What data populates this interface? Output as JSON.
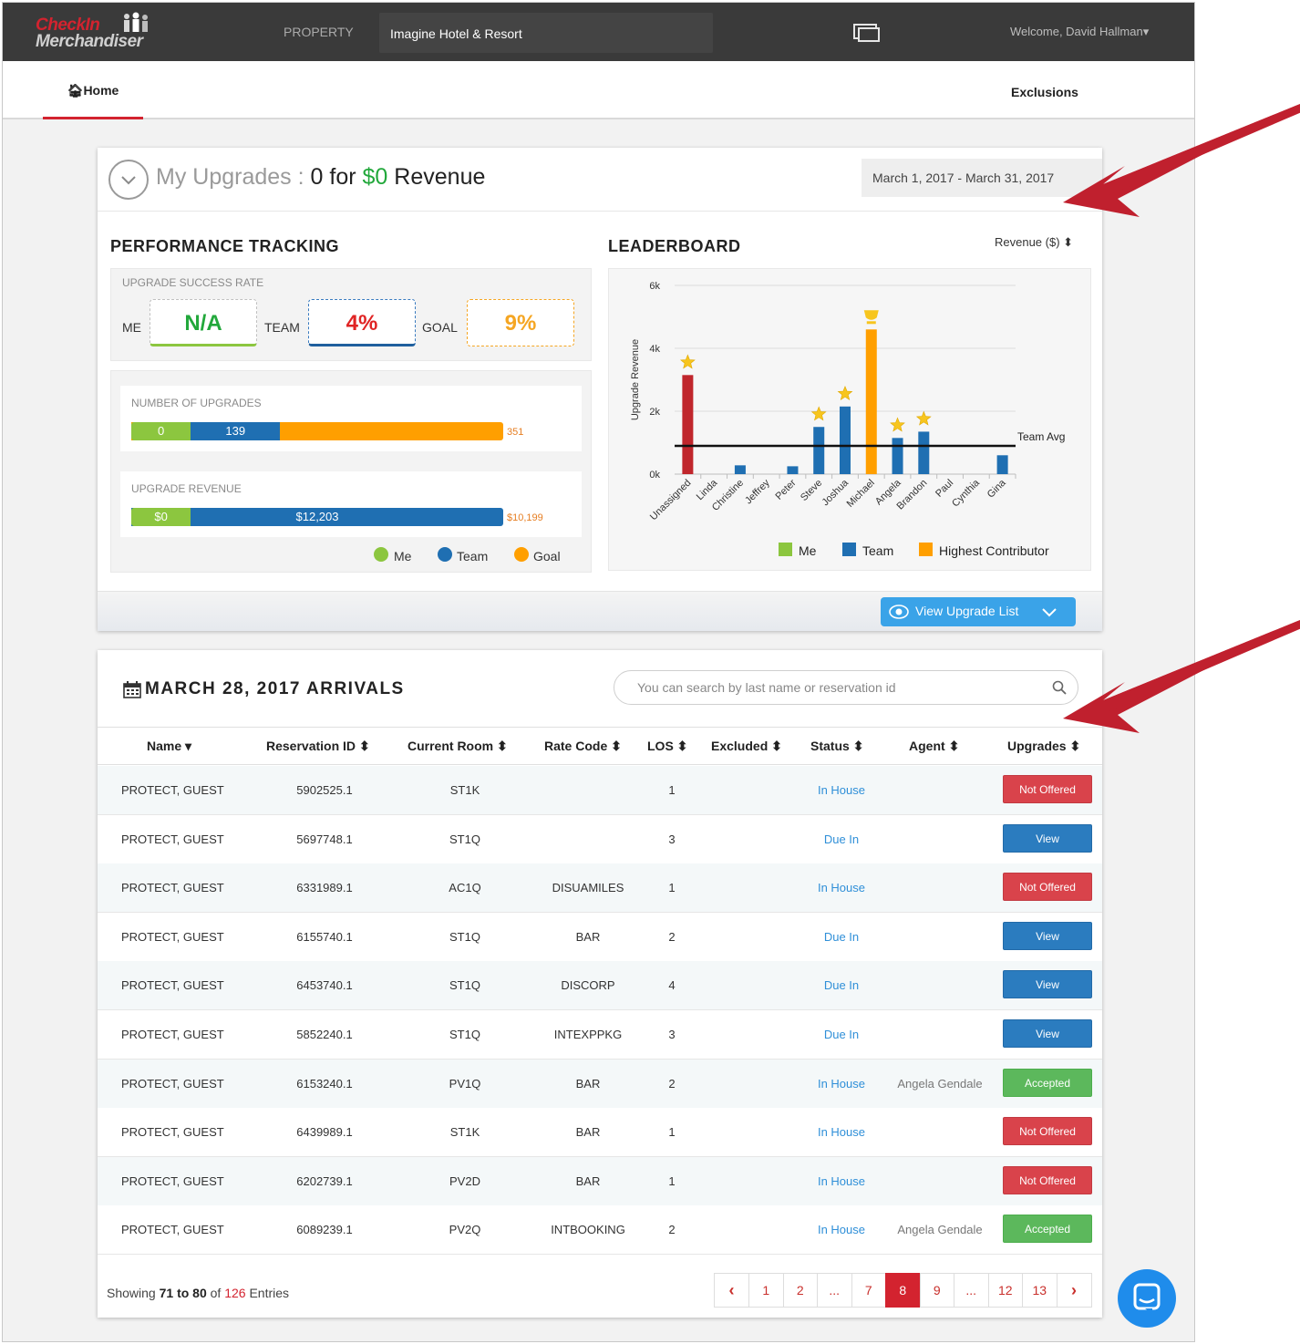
{
  "topbar": {
    "logo_line1": "CheckIn",
    "logo_line2": "Merchandiser",
    "property_label": "PROPERTY",
    "property_value": "Imagine Hotel & Resort",
    "welcome": "Welcome, David Hallman"
  },
  "nav": {
    "home": "Home",
    "exclusions": "Exclusions"
  },
  "upgrades": {
    "title_prefix": "My Upgrades",
    "title_colon": ":",
    "count": "0",
    "for_word": "for",
    "revenue_value": "$0",
    "revenue_word": "Revenue",
    "date_range": "March 1, 2017 - March 31, 2017",
    "performance_title": "PERFORMANCE TRACKING",
    "leaderboard_title": "LEADERBOARD",
    "leaderboard_sort": "Revenue ($)",
    "success_rate_label": "UPGRADE SUCCESS RATE",
    "me_label": "ME",
    "me_value": "N/A",
    "team_label": "TEAM",
    "team_value": "4%",
    "goal_label": "GOAL",
    "goal_value": "9%",
    "num_upgrades_label": "NUMBER OF UPGRADES",
    "num_me": "0",
    "num_team": "139",
    "num_goal": "351",
    "num_me_frac": 0.16,
    "num_team_frac": 0.4,
    "revenue_label": "UPGRADE REVENUE",
    "rev_me": "$0",
    "rev_team": "$12,203",
    "rev_goal": "$10,199",
    "legend_me": "Me",
    "legend_team": "Team",
    "legend_goal": "Goal",
    "view_list_button": "View Upgrade List",
    "colors": {
      "me": "#8cc63f",
      "team": "#1f6fb2",
      "goal": "#ff9f00",
      "unassigned": "#c0262c"
    }
  },
  "chart_data": {
    "type": "bar",
    "ylabel": "Upgrade Revenue",
    "ylim": [
      0,
      6000
    ],
    "yticks": [
      "0k",
      "2k",
      "4k",
      "6k"
    ],
    "categories": [
      "Unassigned",
      "Linda",
      "Christine",
      "Jeffrey",
      "Peter",
      "Steve",
      "Joshua",
      "Michael",
      "Angela",
      "Brandon",
      "Paul",
      "Cynthia",
      "Gina"
    ],
    "values": [
      3150,
      0,
      280,
      0,
      250,
      1500,
      2150,
      4600,
      1150,
      1350,
      0,
      0,
      600
    ],
    "bar_roles": [
      "unassigned",
      "team",
      "team",
      "team",
      "team",
      "team",
      "team",
      "highest",
      "team",
      "team",
      "team",
      "team",
      "team"
    ],
    "stars": [
      true,
      false,
      false,
      false,
      false,
      true,
      true,
      false,
      true,
      true,
      false,
      false,
      false
    ],
    "trophy_index": 7,
    "team_avg": 900,
    "team_avg_label": "Team Avg",
    "legend": [
      "Me",
      "Team",
      "Highest Contributor"
    ]
  },
  "arrivals": {
    "title": "MARCH 28, 2017 ARRIVALS",
    "search_placeholder": "You can search by last name or reservation id",
    "columns": [
      "Name",
      "Reservation ID",
      "Current Room",
      "Rate Code",
      "LOS",
      "Excluded",
      "Status",
      "Agent",
      "Upgrades"
    ],
    "rows": [
      {
        "name": "PROTECT, GUEST",
        "res": "5902525.1",
        "room": "ST1K",
        "rate": "",
        "los": "1",
        "status": "In House",
        "agent": "",
        "upgrade": "Not Offered",
        "kind": "red"
      },
      {
        "name": "PROTECT, GUEST",
        "res": "5697748.1",
        "room": "ST1Q",
        "rate": "",
        "los": "3",
        "status": "Due In",
        "agent": "",
        "upgrade": "View",
        "kind": "blue"
      },
      {
        "name": "PROTECT, GUEST",
        "res": "6331989.1",
        "room": "AC1Q",
        "rate": "DISUAMILES",
        "los": "1",
        "status": "In House",
        "agent": "",
        "upgrade": "Not Offered",
        "kind": "red"
      },
      {
        "name": "PROTECT, GUEST",
        "res": "6155740.1",
        "room": "ST1Q",
        "rate": "BAR",
        "los": "2",
        "status": "Due In",
        "agent": "",
        "upgrade": "View",
        "kind": "blue"
      },
      {
        "name": "PROTECT, GUEST",
        "res": "6453740.1",
        "room": "ST1Q",
        "rate": "DISCORP",
        "los": "4",
        "status": "Due In",
        "agent": "",
        "upgrade": "View",
        "kind": "blue"
      },
      {
        "name": "PROTECT, GUEST",
        "res": "5852240.1",
        "room": "ST1Q",
        "rate": "INTEXPPKG",
        "los": "3",
        "status": "Due In",
        "agent": "",
        "upgrade": "View",
        "kind": "blue"
      },
      {
        "name": "PROTECT, GUEST",
        "res": "6153240.1",
        "room": "PV1Q",
        "rate": "BAR",
        "los": "2",
        "status": "In House",
        "agent": "Angela Gendale",
        "upgrade": "Accepted",
        "kind": "green"
      },
      {
        "name": "PROTECT, GUEST",
        "res": "6439989.1",
        "room": "ST1K",
        "rate": "BAR",
        "los": "1",
        "status": "In House",
        "agent": "",
        "upgrade": "Not Offered",
        "kind": "red"
      },
      {
        "name": "PROTECT, GUEST",
        "res": "6202739.1",
        "room": "PV2D",
        "rate": "BAR",
        "los": "1",
        "status": "In House",
        "agent": "",
        "upgrade": "Not Offered",
        "kind": "red"
      },
      {
        "name": "PROTECT, GUEST",
        "res": "6089239.1",
        "room": "PV2Q",
        "rate": "INTBOOKING",
        "los": "2",
        "status": "In House",
        "agent": "Angela Gendale",
        "upgrade": "Accepted",
        "kind": "green"
      }
    ],
    "showing": {
      "word": "Showing",
      "from": "71",
      "to_word": "to",
      "to": "80",
      "of_word": "of",
      "total": "126",
      "entries": "Entries"
    },
    "pages": [
      "‹",
      "1",
      "2",
      "...",
      "7",
      "8",
      "9",
      "...",
      "12",
      "13",
      "›"
    ],
    "active_page": "8"
  }
}
